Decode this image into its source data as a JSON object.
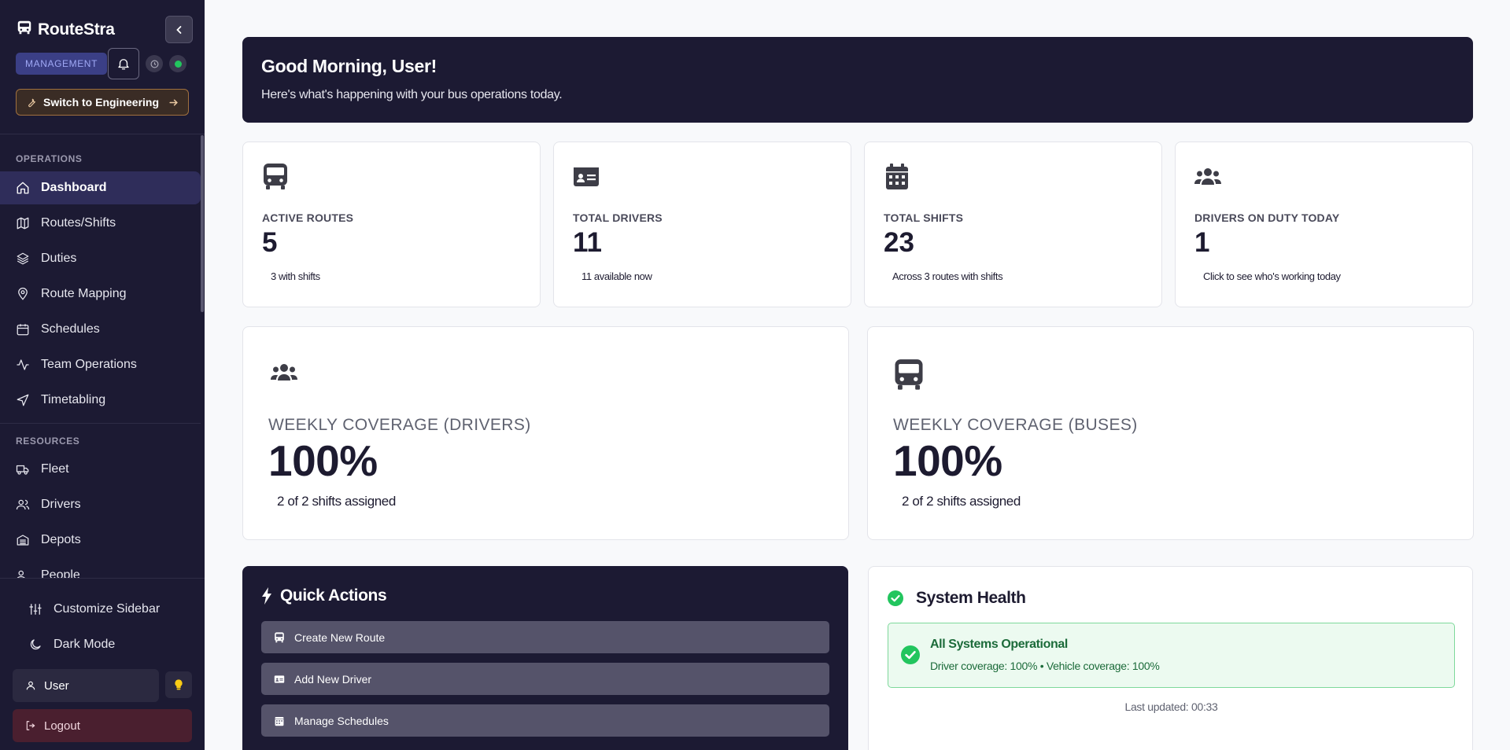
{
  "sidebar": {
    "brand": "RouteStra",
    "role_badge": "MANAGEMENT",
    "switch_label": "Switch to Engineering",
    "sections": [
      {
        "title": "OPERATIONS",
        "items": [
          {
            "label": "Dashboard",
            "icon": "home-icon",
            "active": true
          },
          {
            "label": "Routes/Shifts",
            "icon": "map-icon"
          },
          {
            "label": "Duties",
            "icon": "layers-icon"
          },
          {
            "label": "Route Mapping",
            "icon": "map-pin-icon"
          },
          {
            "label": "Schedules",
            "icon": "calendar-icon"
          },
          {
            "label": "Team Operations",
            "icon": "activity-icon"
          },
          {
            "label": "Timetabling",
            "icon": "send-icon"
          }
        ]
      },
      {
        "title": "RESOURCES",
        "items": [
          {
            "label": "Fleet",
            "icon": "truck-icon"
          },
          {
            "label": "Drivers",
            "icon": "users-icon"
          },
          {
            "label": "Depots",
            "icon": "warehouse-icon"
          },
          {
            "label": "People",
            "icon": "user-group-icon"
          }
        ]
      }
    ],
    "customize_label": "Customize Sidebar",
    "dark_mode_label": "Dark Mode",
    "user_label": "User",
    "logout_label": "Logout",
    "status_color": "#22c55e"
  },
  "welcome": {
    "title": "Good Morning, User!",
    "subtitle": "Here's what's happening with your bus operations today."
  },
  "stats": [
    {
      "icon": "bus-icon",
      "label": "ACTIVE ROUTES",
      "value": "5",
      "sub": "3 with shifts"
    },
    {
      "icon": "id-card-icon",
      "label": "TOTAL DRIVERS",
      "value": "11",
      "sub": "11 available now"
    },
    {
      "icon": "calendar-grid-icon",
      "label": "TOTAL SHIFTS",
      "value": "23",
      "sub": "Across 3 routes with shifts"
    },
    {
      "icon": "users-group-icon",
      "label": "DRIVERS ON DUTY TODAY",
      "value": "1",
      "sub": "Click to see who's working today"
    }
  ],
  "coverage": [
    {
      "icon": "users-group-icon",
      "label": "WEEKLY COVERAGE (DRIVERS)",
      "value": "100%",
      "sub": "2 of 2 shifts assigned"
    },
    {
      "icon": "bus-icon",
      "label": "WEEKLY COVERAGE (BUSES)",
      "value": "100%",
      "sub": "2 of 2 shifts assigned"
    }
  ],
  "quick_actions": {
    "title": "Quick Actions",
    "items": [
      {
        "label": "Create New Route",
        "icon": "bus-small-icon"
      },
      {
        "label": "Add New Driver",
        "icon": "id-card-small-icon"
      },
      {
        "label": "Manage Schedules",
        "icon": "calendar-small-icon"
      }
    ]
  },
  "system_health": {
    "title": "System Health",
    "status_title": "All Systems Operational",
    "status_detail": "Driver coverage: 100% • Vehicle coverage: 100%",
    "last_updated": "Last updated: 00:33",
    "accent": "#22c55e"
  }
}
